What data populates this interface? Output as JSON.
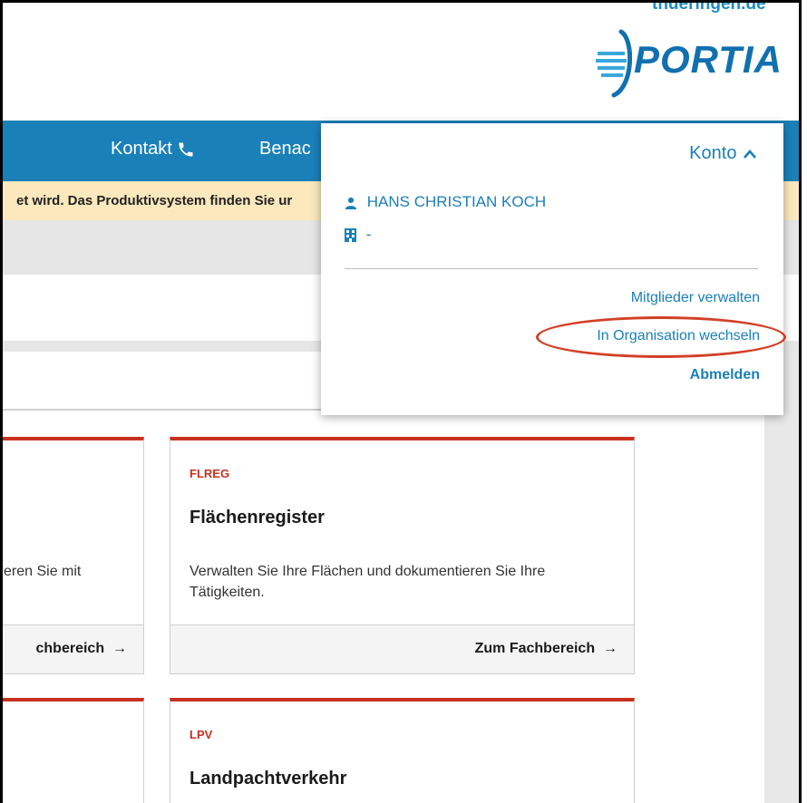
{
  "header": {
    "domain_fragment": "thueringen.de",
    "logo_text": "PORTIA"
  },
  "nav": {
    "kontakt": "Kontakt",
    "benachrichtigungen_partial": "Benac"
  },
  "banner": {
    "text": "et wird. Das Produktivsystem finden Sie ur"
  },
  "cards": [
    {
      "code": "",
      "title": "",
      "description": "eren Sie mit",
      "link": "chbereich"
    },
    {
      "code": "FLREG",
      "title": "Flächenregister",
      "description": "Verwalten Sie Ihre Flächen und dokumentieren Sie Ihre Tätigkeiten.",
      "link": "Zum Fachbereich"
    },
    {
      "code": "LPV",
      "title": "Landpachtverkehr"
    }
  ],
  "account_menu": {
    "title": "Konto",
    "user_name": "HANS CHRISTIAN KOCH",
    "organization": "-",
    "links": {
      "manage_members": "Mitglieder verwalten",
      "switch_organization": "In Organisation wechseln",
      "logout": "Abmelden"
    }
  },
  "colors": {
    "nav_blue": "#1a80b8",
    "accent_red": "#c9301f",
    "banner_yellow": "#fbe8bd"
  }
}
